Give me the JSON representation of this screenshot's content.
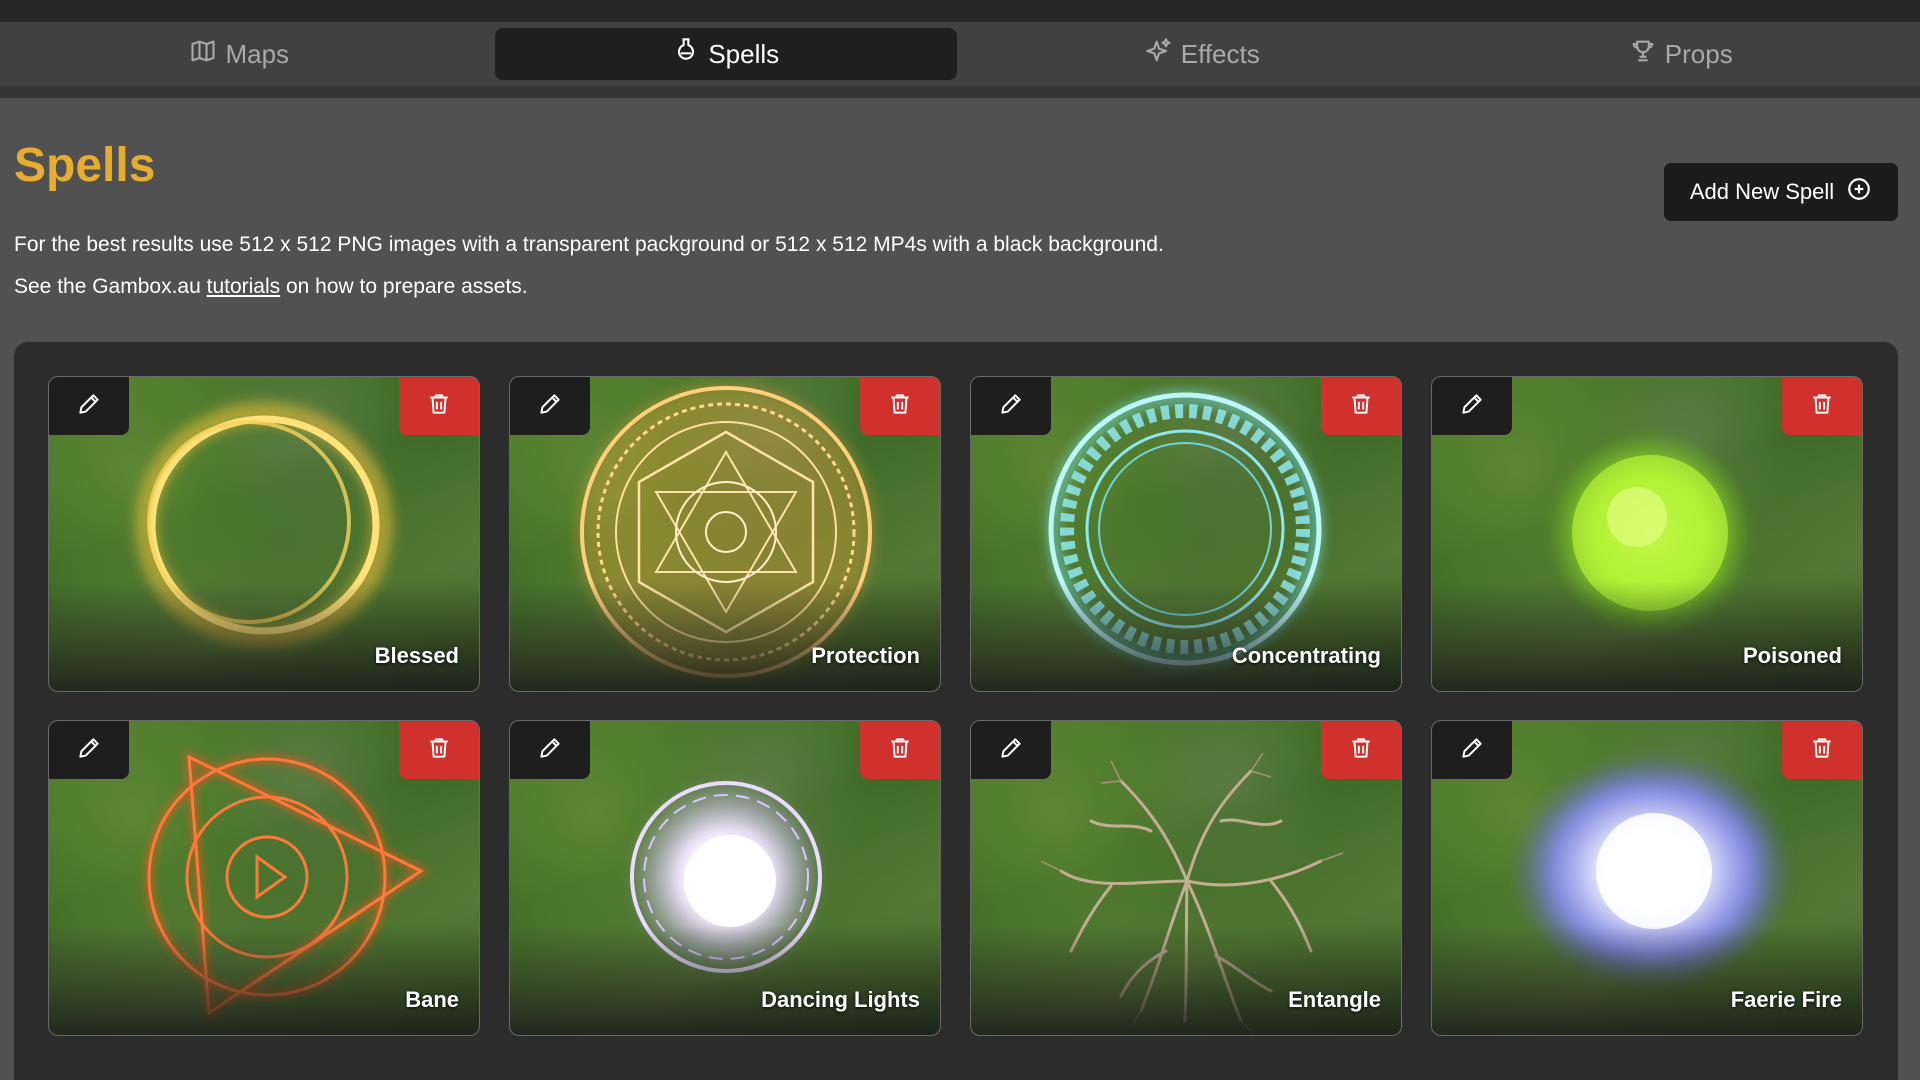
{
  "tabs": [
    {
      "label": "Maps",
      "icon": "map-icon",
      "active": false
    },
    {
      "label": "Spells",
      "icon": "flask-icon",
      "active": true
    },
    {
      "label": "Effects",
      "icon": "sparkles-icon",
      "active": false
    },
    {
      "label": "Props",
      "icon": "trophy-icon",
      "active": false
    }
  ],
  "page": {
    "title": "Spells",
    "add_button_label": "Add New Spell",
    "description_line1": "For the best results use 512 x 512 PNG images with a transparent packground or 512 x 512 MP4s with a black background.",
    "description_line2_prefix": "See the Gambox.au ",
    "description_line2_link": "tutorials",
    "description_line2_suffix": " on how to prepare assets."
  },
  "colors": {
    "accent_title": "#e6ad2f",
    "delete_red": "#d0312d",
    "background": "#515151",
    "panel": "#2c2c2c"
  },
  "spells": [
    {
      "name": "Blessed",
      "art": "golden-ring",
      "color": "#f3c23a"
    },
    {
      "name": "Protection",
      "art": "orange-rune-circle",
      "color": "#f5a53a"
    },
    {
      "name": "Concentrating",
      "art": "cyan-rune-ring",
      "color": "#6fe0e6"
    },
    {
      "name": "Poisoned",
      "art": "green-orb",
      "color": "#a8ef2a"
    },
    {
      "name": "Bane",
      "art": "red-triangle-sigil",
      "color": "#f2561c"
    },
    {
      "name": "Dancing Lights",
      "art": "white-orb",
      "color": "#e9dcff"
    },
    {
      "name": "Entangle",
      "art": "roots",
      "color": "#c2ae92"
    },
    {
      "name": "Faerie Fire",
      "art": "blue-glow",
      "color": "#8a8cff"
    }
  ]
}
